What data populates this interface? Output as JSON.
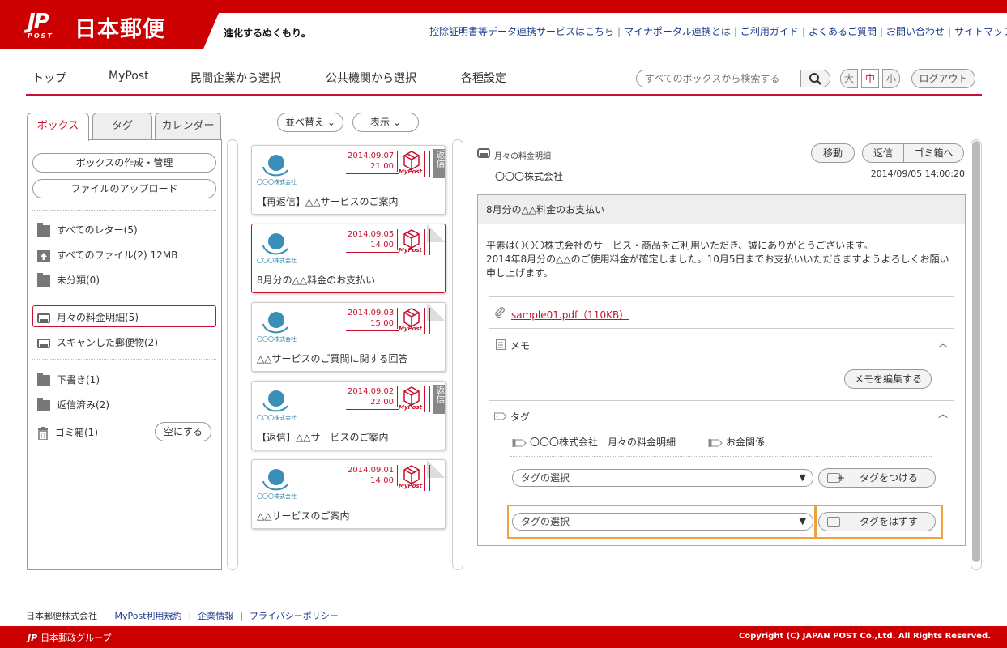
{
  "header": {
    "logo_mark": "JP",
    "logo_post": "POST",
    "logo_name": "日本郵便",
    "tagline": "進化するぬくもり。",
    "links": [
      "控除証明書等データ連携サービスはこちら",
      "マイナポータル連携とは",
      "ご利用ガイド",
      "よくあるご質問",
      "お問い合わせ",
      "サイトマップ"
    ]
  },
  "nav": {
    "items": [
      "トップ",
      "MyPost",
      "民間企業から選択",
      "公共機関から選択",
      "各種設定"
    ],
    "search_placeholder": "すべてのボックスから検索する",
    "font_sizes": [
      "大",
      "中",
      "小"
    ],
    "logout": "ログアウト"
  },
  "left": {
    "tabs": [
      "ボックス",
      "タグ",
      "カレンダー"
    ],
    "buttons": [
      "ボックスの作成・管理",
      "ファイルのアップロード"
    ],
    "items": [
      "すべてのレター(5)",
      "すべてのファイル(2) 12MB",
      "未分類(0)",
      "月々の料金明細(5)",
      "スキャンした郵便物(2)",
      "下書き(1)",
      "返信済み(2)",
      "ゴミ箱(1)"
    ],
    "empty_button": "空にする"
  },
  "middle": {
    "sort_label": "並べ替え",
    "view_label": "表示",
    "company_small": "〇〇〇株式会社",
    "mypost_mark": "MyPost",
    "reply_badge": "返信",
    "cards": [
      {
        "date": "2014.09.07",
        "time": "21:00",
        "title": "【再返信】△△サービスのご案内"
      },
      {
        "date": "2014.09.05",
        "time": "14:00",
        "title": "8月分の△△料金のお支払い"
      },
      {
        "date": "2014.09.03",
        "time": "15:00",
        "title": "△△サービスのご質問に関する回答"
      },
      {
        "date": "2014.09.02",
        "time": "22:00",
        "title": "【返信】△△サービスのご案内"
      },
      {
        "date": "2014.09.01",
        "time": "14:00",
        "title": "△△サービスのご案内"
      }
    ]
  },
  "detail": {
    "box_name": "月々の料金明細",
    "sender": "〇〇〇株式会社",
    "datetime": "2014/09/05 14:00:20",
    "btn_move": "移動",
    "btn_reply": "返信",
    "btn_trash": "ゴミ箱へ",
    "subject": "8月分の△△料金のお支払い",
    "body_1": "平素は〇〇〇株式会社のサービス・商品をご利用いただき、誠にありがとうございます。",
    "body_2": "2014年8月分の△△のご使用料金が確定しました。10月5日までお支払いいただきますようよろしくお願い",
    "body_3": "申し上げます。",
    "attachment": "sample01.pdf（110KB）",
    "memo_label": "メモ",
    "memo_edit": "メモを編集する",
    "tag_label": "タグ",
    "tags": [
      "〇〇〇株式会社　月々の料金明細",
      "お金関係"
    ],
    "tag_select_placeholder": "タグの選択",
    "tag_add": "タグをつける",
    "tag_remove": "タグをはずす"
  },
  "footer": {
    "company": "日本郵便株式会社",
    "links": [
      "MyPost利用規約",
      "企業情報",
      "プライバシーポリシー"
    ],
    "group": "日本郵政グループ",
    "copyright": "Copyright (C) JAPAN POST Co.,Ltd. All Rights Reserved."
  },
  "colors": {
    "brand_red": "#cc0000",
    "accent_red": "#c8102e",
    "highlight": "#f0a040",
    "logo_blue": "#2a7fa8"
  }
}
